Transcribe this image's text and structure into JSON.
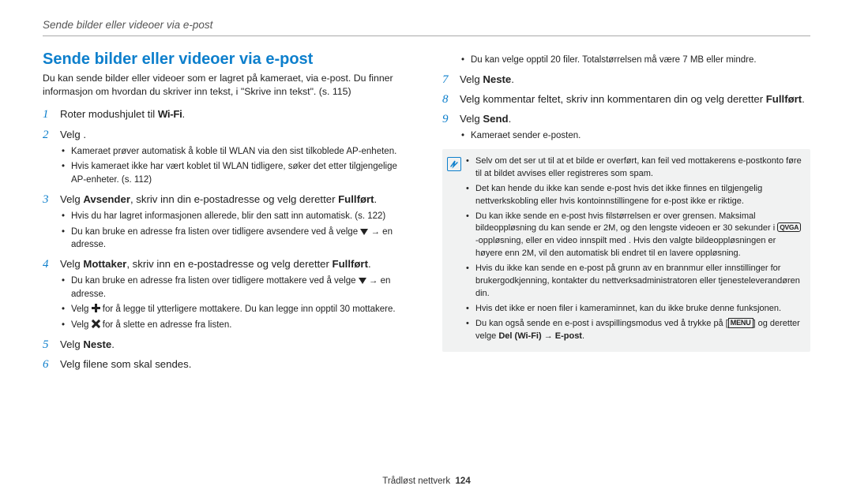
{
  "breadcrumb": "Sende bilder eller videoer via e-post",
  "section_title": "Sende bilder eller videoer via e-post",
  "intro": "Du kan sende bilder eller videoer som er lagret på kameraet, via e-post. Du finner informasjon om hvordan du skriver inn tekst, i \"Skrive inn tekst\". (s. 115)",
  "wifi_label": "Wi-Fi",
  "steps_left": {
    "s1_pre": "Roter modushjulet til ",
    "s1_post": ".",
    "s2": "Velg       .",
    "s2_sub": [
      "Kameraet prøver automatisk å koble til WLAN via den sist tilkoblede AP-enheten.",
      "Hvis kameraet ikke har vært koblet til WLAN tidligere, søker det etter tilgjengelige AP-enheter. (s. 112)"
    ],
    "s3_pre": "Velg ",
    "s3_b1": "Avsender",
    "s3_mid": ", skriv inn din e-postadresse og velg deretter ",
    "s3_b2": "Fullført",
    "s3_post": ".",
    "s3_sub1": "Hvis du har lagret informasjonen allerede, blir den satt inn automatisk. (s. 122)",
    "s3_sub2_pre": "Du kan bruke en adresse fra listen over tidligere avsendere ved å velge ",
    "s3_sub2_post": " → en adresse.",
    "s4_pre": "Velg ",
    "s4_b1": "Mottaker",
    "s4_mid": ", skriv inn en e-postadresse og velg deretter ",
    "s4_b2": "Fullført",
    "s4_post": ".",
    "s4_sub1_pre": "Du kan bruke en adresse fra listen over tidligere mottakere ved å velge ",
    "s4_sub1_post": " → en adresse.",
    "s4_sub2_pre": "Velg ",
    "s4_sub2_post": " for å legge til ytterligere mottakere. Du kan legge inn opptil 30 mottakere.",
    "s4_sub3_pre": "Velg ",
    "s4_sub3_post": " for å slette en adresse fra listen.",
    "s5_pre": "Velg ",
    "s5_b": "Neste",
    "s5_post": ".",
    "s6": "Velg filene som skal sendes."
  },
  "right": {
    "s6_sub": "Du kan velge opptil 20 filer. Totalstørrelsen må være 7 MB eller mindre.",
    "s7_pre": "Velg ",
    "s7_b": "Neste",
    "s7_post": ".",
    "s8_pre": "Velg kommentar feltet, skriv inn kommentaren din og velg deretter ",
    "s8_b": "Fullført",
    "s8_post": ".",
    "s9_pre": "Velg ",
    "s9_b": "Send",
    "s9_post": ".",
    "s9_sub": "Kameraet sender e-posten."
  },
  "note": {
    "n1": "Selv om det ser ut til at et bilde er overført, kan feil ved mottakerens e-postkonto føre til at bildet avvises eller registreres som spam.",
    "n2": "Det kan hende du ikke kan sende e-post hvis det ikke finnes en tilgjengelig nettverkskobling eller hvis kontoinnstillingene for e-post ikke er riktige.",
    "n3_a": "Du kan ikke sende en e-post hvis filstørrelsen er over grensen. Maksimal bildeoppløsning du kan sende er 2M, og den lengste videoen er 30 sekunder i ",
    "n3_chip": "QVGA",
    "n3_b": "-oppløsning, eller en video innspilt med      . Hvis den valgte bildeoppløsningen er høyere enn 2M, vil den automatisk bli endret til en lavere oppløsning.",
    "n4": "Hvis du ikke kan sende en e-post på grunn av en brannmur eller innstillinger for brukergodkjenning, kontakter du nettverksadministratoren eller tjenesteleverandøren din.",
    "n5": "Hvis det ikke er noen filer i kameraminnet, kan du ikke bruke denne funksjonen.",
    "n6_a": "Du kan også sende en e-post i avspillingsmodus ved å trykke på [",
    "n6_menu": "MENU",
    "n6_b": "] og deretter velge ",
    "n6_bold": "Del (Wi-Fi) → E-post",
    "n6_c": "."
  },
  "footer": {
    "label": "Trådløst nettverk",
    "page": "124"
  }
}
